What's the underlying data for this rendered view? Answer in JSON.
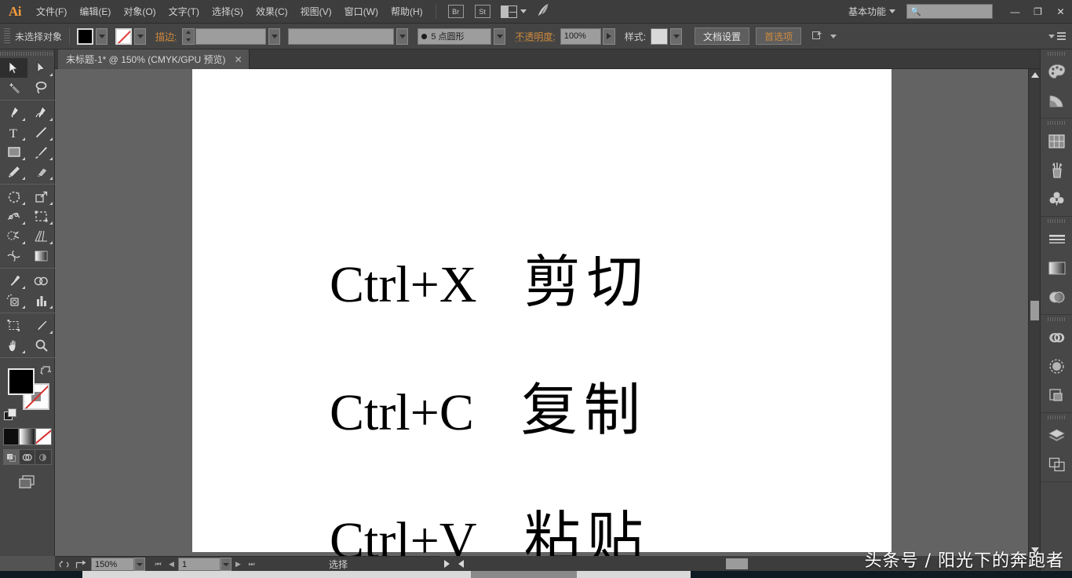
{
  "app": {
    "name": "Ai",
    "logo_color": "#f59b3c"
  },
  "menubar": {
    "items": [
      {
        "label": "文件(F)"
      },
      {
        "label": "编辑(E)"
      },
      {
        "label": "对象(O)"
      },
      {
        "label": "文字(T)"
      },
      {
        "label": "选择(S)"
      },
      {
        "label": "效果(C)"
      },
      {
        "label": "视图(V)"
      },
      {
        "label": "窗口(W)"
      },
      {
        "label": "帮助(H)"
      }
    ],
    "bridge_label": "Br",
    "stock_label": "St",
    "arrange_icon": "arrange-documents-icon",
    "rocket_icon": "rocket-icon",
    "workspace": "基本功能",
    "search_placeholder": "",
    "search_value": "",
    "window_minimize": "—",
    "window_restore": "❐",
    "window_close": "✕"
  },
  "controlbar": {
    "selection_status": "未选择对象",
    "fill_label": "fill-swatch",
    "fill_color": "#000000",
    "stroke_label": "stroke-swatch",
    "stroke_color": "none",
    "stroke_text": "描边:",
    "stroke_weight": "",
    "stroke_profile": "",
    "brush_definition": "5 点圆形",
    "opacity_label": "不透明度:",
    "opacity_value": "100%",
    "style_label": "样式:",
    "doc_setup_button": "文档设置",
    "preferences_button": "首选项",
    "select_similar_icon": "select-similar-objects-icon",
    "panel_menu_icon": "panel-menu-icon"
  },
  "tab": {
    "title": "未标题-1* @ 150% (CMYK/GPU 预览)",
    "close": "✕"
  },
  "toolbar": {
    "tools": [
      {
        "name": "selection-tool",
        "active": true,
        "has_more": false
      },
      {
        "name": "direct-selection-tool",
        "active": false,
        "has_more": true
      },
      {
        "name": "magic-wand-tool",
        "active": false,
        "has_more": false
      },
      {
        "name": "lasso-tool",
        "active": false,
        "has_more": false
      },
      {
        "name": "pen-tool",
        "active": false,
        "has_more": true
      },
      {
        "name": "curvature-tool",
        "active": false,
        "has_more": true
      },
      {
        "name": "type-tool",
        "active": false,
        "has_more": true
      },
      {
        "name": "line-segment-tool",
        "active": false,
        "has_more": true
      },
      {
        "name": "rectangle-tool",
        "active": false,
        "has_more": true
      },
      {
        "name": "paintbrush-tool",
        "active": false,
        "has_more": true
      },
      {
        "name": "pencil-tool",
        "active": false,
        "has_more": true
      },
      {
        "name": "eraser-tool",
        "active": false,
        "has_more": true
      },
      {
        "name": "rotate-tool",
        "active": false,
        "has_more": true
      },
      {
        "name": "scale-tool",
        "active": false,
        "has_more": true
      },
      {
        "name": "width-tool",
        "active": false,
        "has_more": true
      },
      {
        "name": "free-transform-tool",
        "active": false,
        "has_more": true
      },
      {
        "name": "shape-builder-tool",
        "active": false,
        "has_more": true
      },
      {
        "name": "perspective-grid-tool",
        "active": false,
        "has_more": true
      },
      {
        "name": "mesh-tool",
        "active": false,
        "has_more": false
      },
      {
        "name": "gradient-tool",
        "active": false,
        "has_more": false
      },
      {
        "name": "eyedropper-tool",
        "active": false,
        "has_more": true
      },
      {
        "name": "blend-tool",
        "active": false,
        "has_more": false
      },
      {
        "name": "symbol-sprayer-tool",
        "active": false,
        "has_more": true
      },
      {
        "name": "column-graph-tool",
        "active": false,
        "has_more": true
      },
      {
        "name": "artboard-tool",
        "active": false,
        "has_more": false
      },
      {
        "name": "slice-tool",
        "active": false,
        "has_more": true
      },
      {
        "name": "hand-tool",
        "active": false,
        "has_more": true
      },
      {
        "name": "zoom-tool",
        "active": false,
        "has_more": false
      }
    ],
    "fill_color": "#000000",
    "stroke_color": "none",
    "swap_icon": "swap-fill-stroke-icon",
    "default_icon": "default-fill-stroke-icon",
    "color_mode": "color-button",
    "gradient_mode": "gradient-button",
    "none_mode": "none-button",
    "draw_normal": "draw-normal-button",
    "draw_behind": "draw-behind-button",
    "draw_inside": "draw-inside-button",
    "screen_mode": "change-screen-mode-button"
  },
  "canvas": {
    "background_color": "#636363",
    "artboard_color": "#ffffff",
    "lines": [
      {
        "shortcut": "Ctrl+X",
        "meaning": "剪切"
      },
      {
        "shortcut": "Ctrl+C",
        "meaning": "复制"
      },
      {
        "shortcut": "Ctrl+V",
        "meaning": "粘贴"
      }
    ]
  },
  "rightdock": {
    "groups": [
      {
        "items": [
          {
            "name": "color-panel-icon",
            "glyph": "palette"
          },
          {
            "name": "color-guide-panel-icon",
            "glyph": "guide"
          }
        ]
      },
      {
        "items": [
          {
            "name": "swatches-panel-icon",
            "glyph": "swatches"
          },
          {
            "name": "brushes-panel-icon",
            "glyph": "brushes"
          },
          {
            "name": "symbols-panel-icon",
            "glyph": "symbols"
          }
        ]
      },
      {
        "items": [
          {
            "name": "stroke-panel-icon",
            "glyph": "stroke"
          },
          {
            "name": "gradient-panel-icon",
            "glyph": "gradient"
          },
          {
            "name": "transparency-panel-icon",
            "glyph": "transparency"
          }
        ]
      },
      {
        "items": [
          {
            "name": "libraries-panel-icon",
            "glyph": "libraries"
          },
          {
            "name": "appearance-panel-icon",
            "glyph": "appearance"
          },
          {
            "name": "pathfinder-panel-icon",
            "glyph": "pathfinder"
          }
        ]
      },
      {
        "items": [
          {
            "name": "layers-panel-icon",
            "glyph": "layers"
          },
          {
            "name": "artboards-panel-icon",
            "glyph": "artboards"
          }
        ]
      }
    ]
  },
  "statusbar": {
    "undo_icon": "undo-icon",
    "share_icon": "share-icon",
    "zoom_value": "150%",
    "artboard_first": "⏮",
    "artboard_prev": "◀",
    "artboard_number": "1",
    "artboard_next": "▶",
    "artboard_last": "⏭",
    "status_text": "选择"
  },
  "watermark": {
    "text": "头条号 / 阳光下的奔跑者"
  }
}
